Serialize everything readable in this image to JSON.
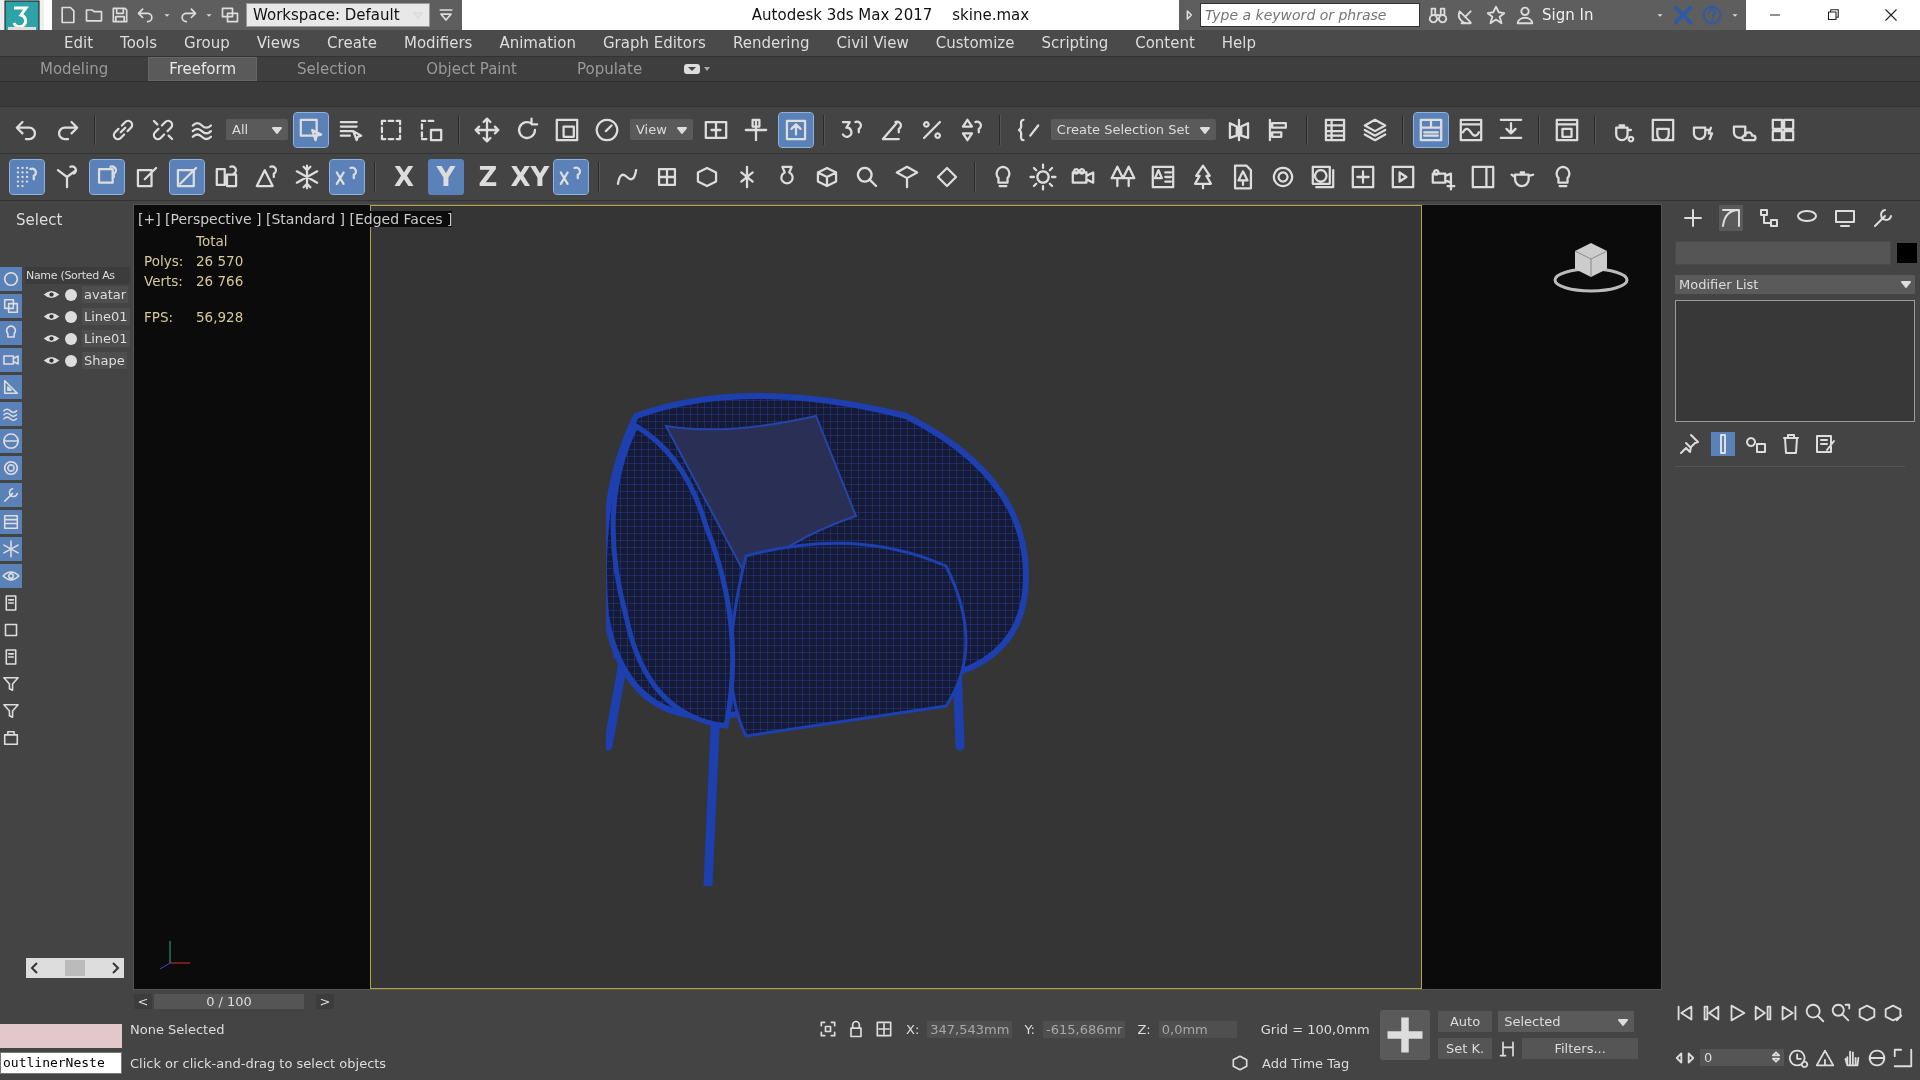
{
  "title_bar": {
    "workspace": "Workspace: Default",
    "title": "Autodesk 3ds Max 2017",
    "file": "skine.max",
    "search": {
      "placeholder": "Type a keyword or phrase"
    },
    "sign_in": "Sign In"
  },
  "menu": [
    "Edit",
    "Tools",
    "Group",
    "Views",
    "Create",
    "Modifiers",
    "Animation",
    "Graph Editors",
    "Rendering",
    "Civil View",
    "Customize",
    "Scripting",
    "Content",
    "Help"
  ],
  "ribbon_tabs": [
    {
      "label": "Modeling",
      "selected": false
    },
    {
      "label": "Freeform",
      "selected": true
    },
    {
      "label": "Selection",
      "selected": false
    },
    {
      "label": "Object Paint",
      "selected": false
    },
    {
      "label": "Populate",
      "selected": false
    }
  ],
  "main_toolbar": [
    {
      "kind": "icon",
      "active": false
    },
    {
      "kind": "icon",
      "active": false
    },
    {
      "kind": "sep"
    },
    {
      "kind": "icon",
      "active": false
    },
    {
      "kind": "icon",
      "active": false
    },
    {
      "kind": "icon",
      "active": false
    },
    {
      "kind": "dropdown",
      "label": "All"
    },
    {
      "kind": "icon",
      "active": true
    },
    {
      "kind": "icon",
      "active": false
    },
    {
      "kind": "icon",
      "active": false
    },
    {
      "kind": "icon",
      "active": false
    },
    {
      "kind": "sep"
    },
    {
      "kind": "icon",
      "active": false
    },
    {
      "kind": "icon",
      "active": false
    },
    {
      "kind": "icon",
      "active": false
    },
    {
      "kind": "icon",
      "active": false
    },
    {
      "kind": "dropdown",
      "label": "View"
    },
    {
      "kind": "icon",
      "active": false
    },
    {
      "kind": "icon",
      "active": false
    },
    {
      "kind": "icon",
      "active": true
    },
    {
      "kind": "sep"
    },
    {
      "kind": "icon",
      "active": false
    },
    {
      "kind": "icon",
      "active": false
    },
    {
      "kind": "icon",
      "active": false
    },
    {
      "kind": "icon",
      "active": false
    },
    {
      "kind": "sep"
    },
    {
      "kind": "icon",
      "active": false
    },
    {
      "kind": "dropdown",
      "label": "Create Selection Set"
    },
    {
      "kind": "icon",
      "active": false
    },
    {
      "kind": "icon",
      "active": false
    },
    {
      "kind": "sep"
    },
    {
      "kind": "icon",
      "active": false
    },
    {
      "kind": "icon",
      "active": false
    },
    {
      "kind": "sep"
    },
    {
      "kind": "icon",
      "active": true
    },
    {
      "kind": "icon",
      "active": false
    },
    {
      "kind": "icon",
      "active": false
    },
    {
      "kind": "sep"
    },
    {
      "kind": "icon",
      "active": false
    },
    {
      "kind": "sep"
    },
    {
      "kind": "icon",
      "active": false
    },
    {
      "kind": "icon",
      "active": false
    },
    {
      "kind": "icon",
      "active": false
    },
    {
      "kind": "icon",
      "active": false
    },
    {
      "kind": "icon",
      "active": false
    }
  ],
  "snap_toolbar": [
    {
      "kind": "icon",
      "active": true
    },
    {
      "kind": "icon",
      "active": false
    },
    {
      "kind": "icon",
      "active": true
    },
    {
      "kind": "icon",
      "active": false
    },
    {
      "kind": "icon",
      "active": true
    },
    {
      "kind": "icon",
      "active": false
    },
    {
      "kind": "icon",
      "active": false
    },
    {
      "kind": "icon",
      "active": false
    },
    {
      "kind": "icon",
      "active": true
    },
    {
      "kind": "sep"
    },
    {
      "kind": "axis",
      "label": "X",
      "active": false
    },
    {
      "kind": "axis",
      "label": "Y",
      "active": true
    },
    {
      "kind": "axis",
      "label": "Z",
      "active": false
    },
    {
      "kind": "axis",
      "label": "XY",
      "active": false
    },
    {
      "kind": "icon",
      "active": true
    },
    {
      "kind": "sep"
    },
    {
      "kind": "icon",
      "active": false
    },
    {
      "kind": "icon",
      "active": false
    },
    {
      "kind": "icon",
      "active": false
    },
    {
      "kind": "icon",
      "active": false
    },
    {
      "kind": "icon",
      "active": false
    },
    {
      "kind": "icon",
      "active": false
    },
    {
      "kind": "icon",
      "active": false
    },
    {
      "kind": "icon",
      "active": false
    },
    {
      "kind": "icon",
      "active": false
    },
    {
      "kind": "sep"
    },
    {
      "kind": "icon",
      "active": false
    },
    {
      "kind": "icon",
      "active": false
    },
    {
      "kind": "icon",
      "active": false
    },
    {
      "kind": "icon",
      "active": false
    },
    {
      "kind": "icon",
      "active": false
    },
    {
      "kind": "icon",
      "active": false
    },
    {
      "kind": "icon",
      "active": false
    },
    {
      "kind": "icon",
      "active": false
    },
    {
      "kind": "icon",
      "active": false
    },
    {
      "kind": "icon",
      "active": false
    },
    {
      "kind": "icon",
      "active": false
    },
    {
      "kind": "icon",
      "active": false
    },
    {
      "kind": "icon",
      "active": false
    },
    {
      "kind": "icon",
      "active": false
    },
    {
      "kind": "icon",
      "active": false
    }
  ],
  "scene_explorer": {
    "title": "Select",
    "column": "Name (Sorted As",
    "tools": [
      {
        "on": true
      },
      {
        "on": true
      },
      {
        "on": true
      },
      {
        "on": true
      },
      {
        "on": true
      },
      {
        "on": true
      },
      {
        "on": true
      },
      {
        "on": true
      },
      {
        "on": true
      },
      {
        "on": true
      },
      {
        "on": true
      },
      {
        "on": true
      },
      {
        "on": false
      },
      {
        "on": false
      },
      {
        "on": false
      },
      {
        "on": false
      },
      {
        "on": false
      },
      {
        "on": false
      }
    ],
    "objects": [
      {
        "name": "avatar"
      },
      {
        "name": "Line01"
      },
      {
        "name": "Line01"
      },
      {
        "name": "Shape"
      }
    ]
  },
  "viewport": {
    "label": "[+] [Perspective ] [Standard ] [Edged Faces ]",
    "stats": {
      "header": "Total",
      "rows": [
        {
          "label": "Polys:",
          "value": "26 570"
        },
        {
          "label": "Verts:",
          "value": "26 766"
        },
        {
          "label": "FPS:",
          "value": "56,928"
        }
      ]
    }
  },
  "command_panel": {
    "modifier_list": "Modifier List",
    "tabs": [
      {
        "selected": false
      },
      {
        "selected": true
      },
      {
        "selected": false
      },
      {
        "selected": false
      },
      {
        "selected": false
      },
      {
        "selected": false
      }
    ],
    "stack_tools": [
      {
        "active": false
      },
      {
        "active": true
      },
      {
        "active": false
      },
      {
        "active": false
      },
      {
        "active": false
      }
    ]
  },
  "time_slider": {
    "label": "0 / 100",
    "prev": "<",
    "next": ">"
  },
  "status_bar": {
    "listener": "outlinerNeste",
    "selection": "None Selected",
    "prompt": "Click or click-and-drag to select objects",
    "x": {
      "label": "X:",
      "value": "347,543mm"
    },
    "y": {
      "label": "Y:",
      "value": "-615,686mr"
    },
    "z": {
      "label": "Z:",
      "value": "0,0mm"
    },
    "grid": "Grid = 100,0mm",
    "time_tag": "Add Time Tag",
    "auto": "Auto",
    "key_filter": "Selected",
    "set_key": "Set K.",
    "filters": "Filters...",
    "frame": "0"
  }
}
